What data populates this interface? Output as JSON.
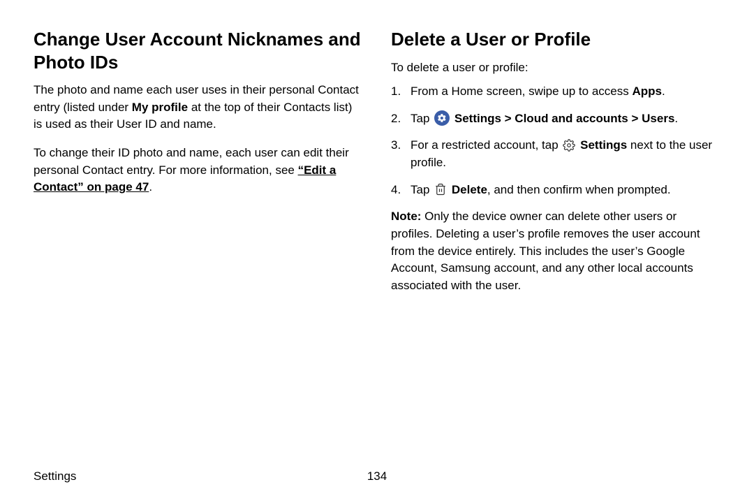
{
  "left": {
    "heading": "Change User Account Nicknames and Photo IDs",
    "para1_a": "The photo and name each user uses in their personal Contact entry (listed under ",
    "para1_bold": "My profile",
    "para1_b": " at the top of their Contacts list) is used as their User ID and name.",
    "para2_a": "To change their ID photo and name, each user can edit their personal Contact entry. For more information, see ",
    "para2_link": "“Edit a Contact” on page 47",
    "para2_b": "."
  },
  "right": {
    "heading": "Delete a User or Profile",
    "intro": "To delete a user or profile:",
    "step1_a": "From a Home screen, swipe up to access ",
    "step1_bold": "Apps",
    "step1_b": ".",
    "step2_a": "Tap ",
    "step2_bold": "Settings > Cloud and accounts > Users",
    "step2_b": ".",
    "step3_a": "For a restricted account, tap ",
    "step3_bold": "Settings",
    "step3_b": " next to the user profile.",
    "step4_a": "Tap ",
    "step4_bold": "Delete",
    "step4_b": ", and then confirm when prompted.",
    "note_label": "Note: ",
    "note_body": "Only the device owner can delete other users or profiles. Deleting a user’s profile removes the user account from the device entirely. This includes the user’s Google Account, Samsung account, and any other local accounts associated with the user."
  },
  "footer": {
    "section": "Settings",
    "page": "134"
  }
}
